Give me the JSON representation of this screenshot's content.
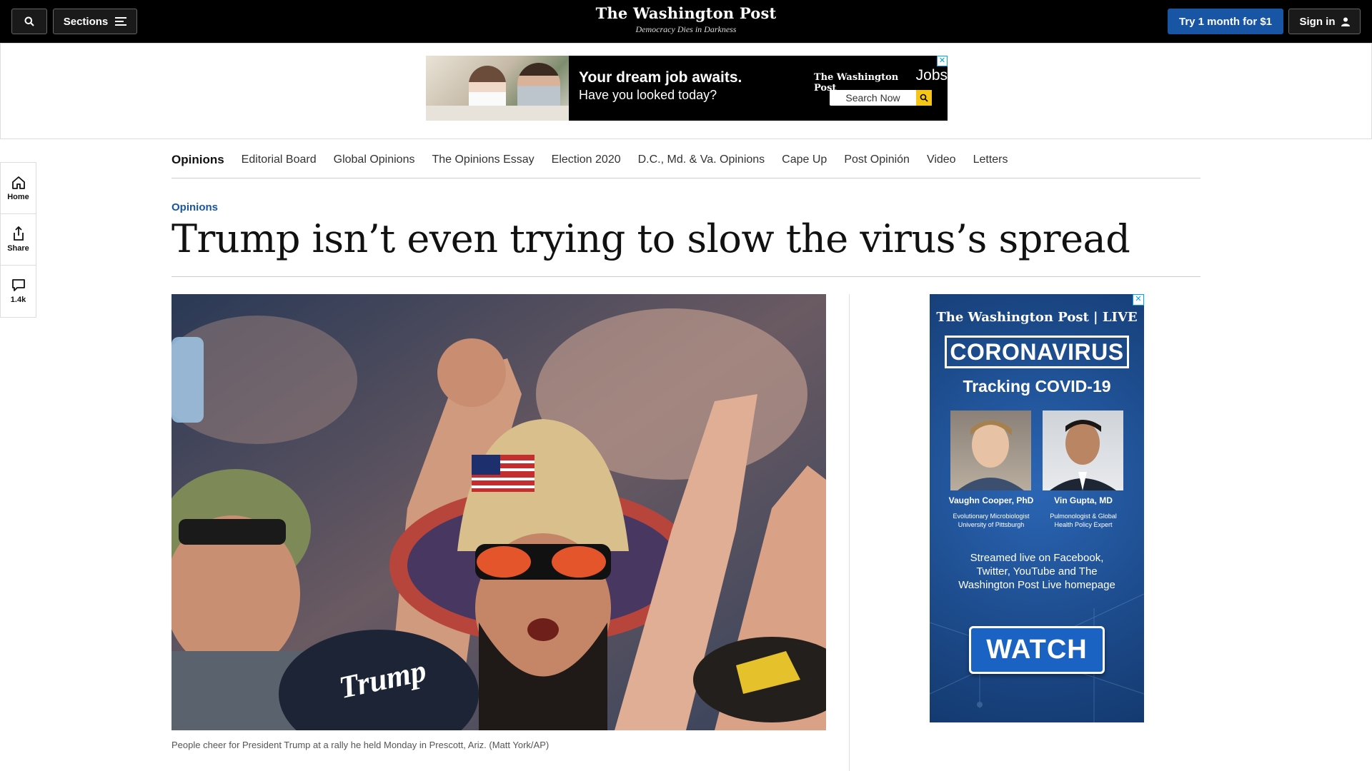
{
  "topbar": {
    "sections_label": "Sections",
    "logo_name": "The Washington Post",
    "logo_tagline": "Democracy Dies in Darkness",
    "try_label": "Try 1 month for $1",
    "signin_label": "Sign in"
  },
  "top_ad": {
    "headline": "Your dream job awaits.",
    "subline": "Have you looked today?",
    "brand_logo": "The Washington Post",
    "brand_product": "Jobs",
    "search_label": "Search Now",
    "close": "✕"
  },
  "section_nav": {
    "items": [
      {
        "label": "Opinions"
      },
      {
        "label": "Editorial Board"
      },
      {
        "label": "Global Opinions"
      },
      {
        "label": "The Opinions Essay"
      },
      {
        "label": "Election 2020"
      },
      {
        "label": "D.C., Md. & Va. Opinions"
      },
      {
        "label": "Cape Up"
      },
      {
        "label": "Post Opinión"
      },
      {
        "label": "Video"
      },
      {
        "label": "Letters"
      }
    ]
  },
  "rail": {
    "home_label": "Home",
    "share_label": "Share",
    "comments_count": "1.4k"
  },
  "article": {
    "kicker": "Opinions",
    "headline": "Trump isn’t even trying to slow the virus’s spread",
    "caption": "People cheer for President Trump at a rally he held Monday in Prescott, Ariz. (Matt York/AP)",
    "photo_hat_text": "Trump"
  },
  "side_ad": {
    "close": "✕",
    "brand": "The Washington Post | LIVE",
    "box_title": "CORONAVIRUS",
    "tracking": "Tracking COVID-19",
    "speaker1_name": "Vaughn Cooper, PhD",
    "speaker1_role_line1": "Evolutionary Microbiologist",
    "speaker1_role_line2": "University of Pittsburgh",
    "speaker2_name": "Vin Gupta, MD",
    "speaker2_role_line1": "Pulmonologist & Global",
    "speaker2_role_line2": "Health Policy Expert",
    "stream_text": "Streamed live on Facebook, Twitter, YouTube and The Washington Post Live homepage",
    "watch_label": "WATCH"
  },
  "colors": {
    "accent_blue": "#1955a5",
    "topbar_bg": "#000000",
    "ad_blue": "#1d4d8f"
  }
}
